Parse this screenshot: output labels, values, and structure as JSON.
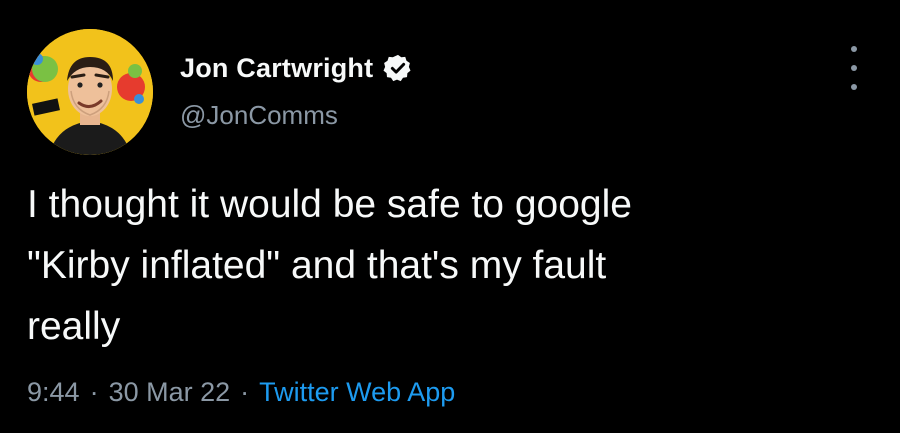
{
  "user": {
    "display_name": "Jon Cartwright",
    "handle": "@JonComms",
    "verified": true,
    "avatar_icon": "cartoon-avatar-icon",
    "avatar_bg": "#f2c21b"
  },
  "tweet": {
    "text": "I thought it would be safe to google\n\"Kirby inflated\" and that's my fault\nreally",
    "time": "9:44",
    "date": "30 Mar 22",
    "source": "Twitter Web App",
    "separator": "·"
  },
  "colors": {
    "background": "#000000",
    "primary_text": "#f7f9f9",
    "secondary_text": "#8b98a5",
    "accent": "#1d9bf0"
  }
}
